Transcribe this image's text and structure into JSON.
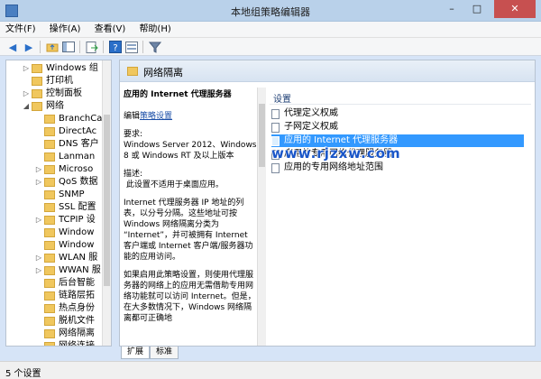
{
  "window": {
    "title": "本地组策略编辑器",
    "controls": {
      "minimize": "–",
      "maximize": "□",
      "close": "✕"
    }
  },
  "menu": [
    "文件(F)",
    "操作(A)",
    "查看(V)",
    "帮助(H)"
  ],
  "toolbar": {
    "icons": [
      "back-icon",
      "forward-icon",
      "up-folder-icon",
      "show-tree-icon",
      "export-icon",
      "help-icon",
      "properties-icon",
      "filter-icon"
    ]
  },
  "tree": {
    "items": [
      {
        "label": "Windows 组",
        "arrow": "▷",
        "level": 1
      },
      {
        "label": "打印机",
        "arrow": "",
        "level": 1
      },
      {
        "label": "控制面板",
        "arrow": "▷",
        "level": 1
      },
      {
        "label": "网络",
        "arrow": "◢",
        "level": 1
      },
      {
        "label": "BranchCa",
        "arrow": "",
        "level": 2
      },
      {
        "label": "DirectAc",
        "arrow": "",
        "level": 2
      },
      {
        "label": "DNS 客户",
        "arrow": "",
        "level": 2
      },
      {
        "label": "Lanman",
        "arrow": "",
        "level": 2
      },
      {
        "label": "Microso",
        "arrow": "▷",
        "level": 2
      },
      {
        "label": "QoS 数据",
        "arrow": "▷",
        "level": 2
      },
      {
        "label": "SNMP",
        "arrow": "",
        "level": 2
      },
      {
        "label": "SSL 配置",
        "arrow": "",
        "level": 2
      },
      {
        "label": "TCPIP 设",
        "arrow": "▷",
        "level": 2
      },
      {
        "label": "Window",
        "arrow": "",
        "level": 2
      },
      {
        "label": "Window",
        "arrow": "",
        "level": 2
      },
      {
        "label": "WLAN 服",
        "arrow": "▷",
        "level": 2
      },
      {
        "label": "WWAN 服",
        "arrow": "▷",
        "level": 2
      },
      {
        "label": "后台智能",
        "arrow": "",
        "level": 2
      },
      {
        "label": "链路层拓",
        "arrow": "",
        "level": 2
      },
      {
        "label": "热点身份",
        "arrow": "",
        "level": 2
      },
      {
        "label": "脱机文件",
        "arrow": "",
        "level": 2
      },
      {
        "label": "网络隔离",
        "arrow": "",
        "level": 2
      },
      {
        "label": "网络连接",
        "arrow": "",
        "level": 2
      }
    ]
  },
  "right": {
    "header_title": "网络隔离",
    "description": {
      "heading": "应用的 Internet 代理服务器",
      "edit_prefix": "编辑",
      "edit_link": "策略设置",
      "requirements_label": "要求:",
      "requirements_text": "Windows Server 2012、Windows 8 或 Windows RT 及以上版本",
      "desc_label": "描述:",
      "desc_text": "此设置不适用于桌面应用。",
      "para1": "Internet 代理服务器 IP 地址的列表，以分号分隔。这些地址可按 Windows 网络隔离分类为 “Internet”，并可被拥有 Internet 客户端或 Internet 客户端/服务器功能的应用访问。",
      "para2": "如果启用此策略设置，则使用代理服务器的网络上的应用无需借助专用网络功能就可以访问 Internet。但是，在大多数情况下，Windows 网络隔离都可正确地"
    },
    "list_header": "设置",
    "settings": [
      {
        "label": "代理定义权威",
        "selected": false
      },
      {
        "label": "子网定义权威",
        "selected": false
      },
      {
        "label": "应用的 Internet 代理服务器",
        "selected": true
      },
      {
        "label": "应用的专用网络代理服务器",
        "selected": false
      },
      {
        "label": "应用的专用网络地址范围",
        "selected": false
      }
    ],
    "watermark": "www.rjzxw.com"
  },
  "tabs": [
    {
      "label": "扩展",
      "active": true
    },
    {
      "label": "标准",
      "active": false
    }
  ],
  "status": {
    "text": "5 个设置"
  },
  "colors": {
    "selection": "#3399ff",
    "link": "#1a4ea7",
    "close_button": "#c75050"
  }
}
